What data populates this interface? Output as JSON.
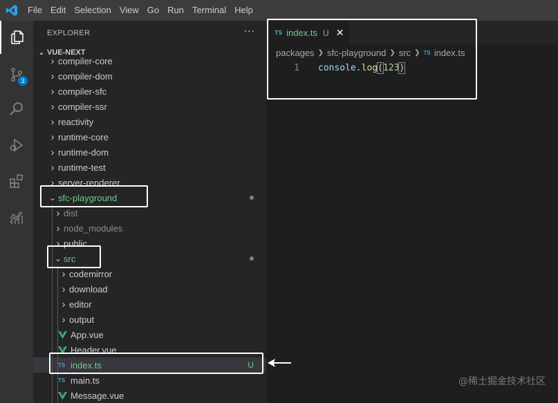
{
  "menubar": {
    "items": [
      "File",
      "Edit",
      "Selection",
      "View",
      "Go",
      "Run",
      "Terminal",
      "Help"
    ]
  },
  "activitybar": {
    "icons": [
      "files-icon",
      "source-control-icon",
      "search-icon",
      "run-debug-icon",
      "extensions-icon",
      "analytics-icon"
    ],
    "scm_badge": "3"
  },
  "sidebar": {
    "title": "EXPLORER",
    "more": "···",
    "root": "VUE-NEXT",
    "tree": [
      {
        "label": "compiler-core",
        "type": "folder",
        "depth": 1
      },
      {
        "label": "compiler-dom",
        "type": "folder",
        "depth": 1
      },
      {
        "label": "compiler-sfc",
        "type": "folder",
        "depth": 1
      },
      {
        "label": "compiler-ssr",
        "type": "folder",
        "depth": 1
      },
      {
        "label": "reactivity",
        "type": "folder",
        "depth": 1
      },
      {
        "label": "runtime-core",
        "type": "folder",
        "depth": 1
      },
      {
        "label": "runtime-dom",
        "type": "folder",
        "depth": 1
      },
      {
        "label": "runtime-test",
        "type": "folder",
        "depth": 1
      },
      {
        "label": "server-renderer",
        "type": "folder",
        "depth": 1
      },
      {
        "label": "sfc-playground",
        "type": "folder-open",
        "depth": 1,
        "status": "dot"
      },
      {
        "label": "dist",
        "type": "folder",
        "depth": 2,
        "dim": true
      },
      {
        "label": "node_modules",
        "type": "folder",
        "depth": 2,
        "dim": true
      },
      {
        "label": "public",
        "type": "folder",
        "depth": 2
      },
      {
        "label": "src",
        "type": "folder-open",
        "depth": 2,
        "status": "dot"
      },
      {
        "label": "codemirror",
        "type": "folder",
        "depth": 3
      },
      {
        "label": "download",
        "type": "folder",
        "depth": 3
      },
      {
        "label": "editor",
        "type": "folder",
        "depth": 3
      },
      {
        "label": "output",
        "type": "folder",
        "depth": 3
      },
      {
        "label": "App.vue",
        "type": "vue",
        "depth": 3
      },
      {
        "label": "Header.vue",
        "type": "vue",
        "depth": 3
      },
      {
        "label": "index.ts",
        "type": "ts",
        "depth": 3,
        "status": "U",
        "selected": true
      },
      {
        "label": "main.ts",
        "type": "ts",
        "depth": 3
      },
      {
        "label": "Message.vue",
        "type": "vue",
        "depth": 3
      }
    ],
    "ts_icon": "TS"
  },
  "editor": {
    "tab": {
      "label": "index.ts",
      "status": "U",
      "close": "✕",
      "icon": "TS"
    },
    "breadcrumbs": [
      "packages",
      "sfc-playground",
      "src",
      "index.ts"
    ],
    "line_number": "1",
    "code": {
      "obj": "console",
      "dot": ".",
      "fn": "log",
      "open": "(",
      "num": "123",
      "close": ")"
    }
  },
  "watermark": "@稀土掘金技术社区",
  "colors": {
    "accent": "#007acc",
    "untracked_green": "#73c991",
    "ts_blue": "#519aba",
    "vue_green": "#41b883"
  }
}
